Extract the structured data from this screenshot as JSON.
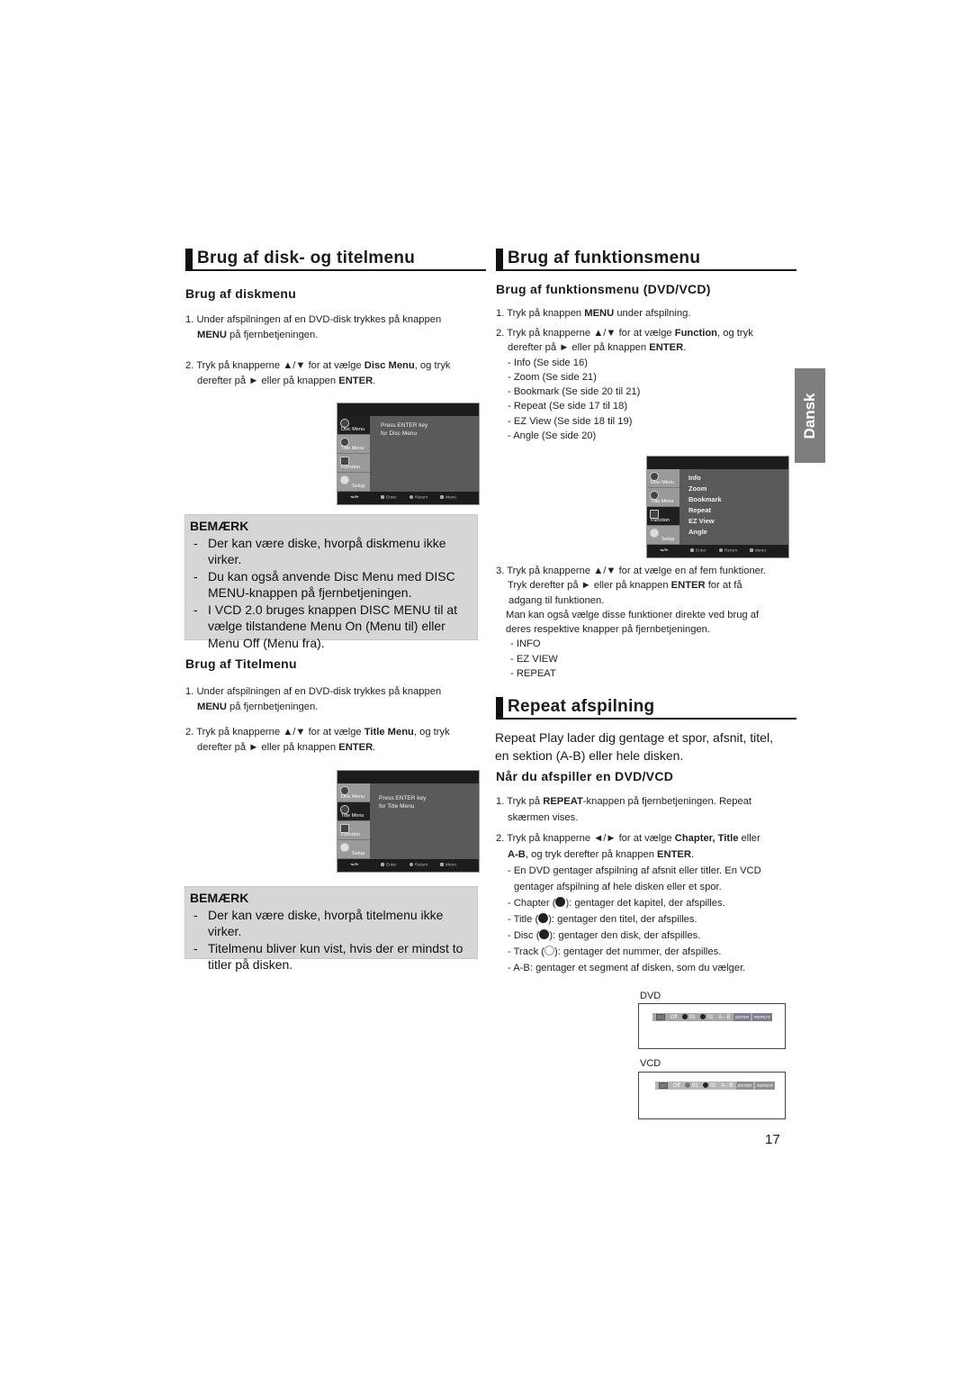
{
  "left": {
    "section_title": "Brug af disk- og titelmenu",
    "diskmenu": {
      "heading": "Brug af diskmenu",
      "step1_a": "1. Under afspilningen af en DVD-disk trykkes på knappen",
      "step1_b_bold": "MENU",
      "step1_b": " på fjernbetjeningen.",
      "step2_a1": "2. Tryk på knapperne ▲/▼ for at vælge ",
      "step2_a_bold": "Disc Menu",
      "step2_a2": ", og tryk",
      "step2_b1": "derefter på ► eller på knappen ",
      "step2_b_bold": "ENTER",
      "step2_b2": ".",
      "osd": {
        "tabs": [
          "Disc Menu",
          "Title Menu",
          "Function",
          "Setup"
        ],
        "selected": "Disc Menu",
        "message_line1": "Press ENTER key",
        "message_line2": "for Disc Menu",
        "footer": [
          "Enter",
          "Return",
          "Menu"
        ]
      },
      "note": {
        "title": "BEMÆRK",
        "items": [
          "Der kan være diske, hvorpå diskmenu ikke virker.",
          "Du kan også anvende Disc Menu med DISC MENU-knappen på fjernbetjeningen.",
          "I VCD 2.0 bruges knappen DISC MENU til at vælge tilstandene Menu On (Menu til) eller Menu Off (Menu fra)."
        ]
      }
    },
    "titelmenu": {
      "heading": "Brug af Titelmenu",
      "step1_a": "1. Under afspilningen af en DVD-disk trykkes på knappen",
      "step1_b_bold": "MENU",
      "step1_b": " på fjernbetjeningen.",
      "step2_a1": "2. Tryk på knapperne ▲/▼ for at vælge ",
      "step2_a_bold": "Title Menu",
      "step2_a2": ", og tryk",
      "step2_b1": "derefter på ► eller på knappen ",
      "step2_b_bold": "ENTER",
      "step2_b2": ".",
      "osd": {
        "tabs": [
          "Disc Menu",
          "Title Menu",
          "Function",
          "Setup"
        ],
        "selected": "Title Menu",
        "message_line1": "Press ENTER key",
        "message_line2": "for Title Menu",
        "footer": [
          "Enter",
          "Return",
          "Menu"
        ]
      },
      "note": {
        "title": "BEMÆRK",
        "items": [
          "Der kan være diske, hvorpå titelmenu ikke virker.",
          "Titelmenu bliver kun vist, hvis der er mindst to titler på disken."
        ]
      }
    }
  },
  "right": {
    "section_title": "Brug af funktionsmenu",
    "funktion": {
      "heading": "Brug af funktionsmenu (DVD/VCD)",
      "step1_a": "1. Tryk på knappen ",
      "step1_bold": "MENU",
      "step1_b": " under afspilning.",
      "step2_a1": "2. Tryk på knapperne ▲/▼ for at vælge ",
      "step2_a_bold": "Function",
      "step2_a2": ", og tryk",
      "step2_b1": "derefter på ► eller på knappen ",
      "step2_b_bold": "ENTER",
      "step2_b2": ".",
      "refs": [
        "- Info (Se side 16)",
        "- Zoom (Se side 21)",
        "- Bookmark (Se side 20 til 21)",
        "- Repeat (Se side 17 til 18)",
        "- EZ View (Se side 18 til 19)",
        "- Angle (Se side  20)"
      ],
      "osd": {
        "tabs": [
          "Disc Menu",
          "Title Menu",
          "Function",
          "Setup"
        ],
        "selected": "Function",
        "items": [
          "Info",
          "Zoom",
          "Bookmark",
          "Repeat",
          "EZ View",
          "Angle"
        ],
        "footer": [
          "Enter",
          "Return",
          "Menu"
        ]
      },
      "step3_a": "3. Tryk på knapperne ▲/▼ for at vælge en af fem funktioner.",
      "step3_b1": "Tryk derefter på ► eller på knappen ",
      "step3_b_bold": "ENTER",
      "step3_b2": " for at få",
      "step3_c": "adgang til funktionen.",
      "step3_d": "Man kan også vælge disse funktioner direkte ved brug af",
      "step3_e": "deres respektive knapper på  fjernbetjeningen.",
      "direct_buttons": [
        "- INFO",
        "- EZ VIEW",
        "- REPEAT"
      ]
    },
    "repeat": {
      "section_title": "Repeat afspilning",
      "intro_line1": "Repeat Play lader dig gentage et spor, afsnit, titel,",
      "intro_line2": "en sektion (A-B) eller hele disken.",
      "heading": "Når du afspiller en DVD/VCD",
      "step1_a1": "1. Tryk på ",
      "step1_bold": "REPEAT",
      "step1_a2": "-knappen på fjernbetjeningen. Repeat",
      "step1_b": "skærmen vises.",
      "step2_a1": "2. Tryk på knapperne ◄/► for at vælge ",
      "step2_a_bold": "Chapter, Title",
      "step2_a2": " eller",
      "step2_b_bold": "A-B",
      "step2_b": ", og tryk derefter på knappen ",
      "step2_b_bold2": "ENTER",
      "step2_b_end": ".",
      "details": [
        "- En DVD gentager afspilning af afsnit eller titler. En VCD",
        "gentager afspilning af hele disken eller et spor."
      ],
      "modes": [
        {
          "pre": "- Chapter (",
          "icon": "chapter-repeat-icon",
          "post": "): gentager det kapitel, der afspilles."
        },
        {
          "pre": "- Title (",
          "icon": "title-repeat-icon",
          "post": "): gentager den titel, der afspilles."
        },
        {
          "pre": "- Disc (",
          "icon": "disc-repeat-icon",
          "post": "): gentager den disk, der afspilles."
        },
        {
          "pre": "- Track (",
          "icon": "track-repeat-icon",
          "post": "): gentager det nummer, der afspilles."
        }
      ],
      "ab_line": "- A-B: gentager et segment af disken, som du vælger.",
      "dvd_label": "DVD",
      "vcd_label": "VCD",
      "bar": {
        "state": "Off",
        "chapter": "01",
        "title": "01",
        "ab": "A - B",
        "btn1": "ENTER",
        "btn2": "REPEAT"
      }
    }
  },
  "side_tab": "Dansk",
  "page_number": "17"
}
